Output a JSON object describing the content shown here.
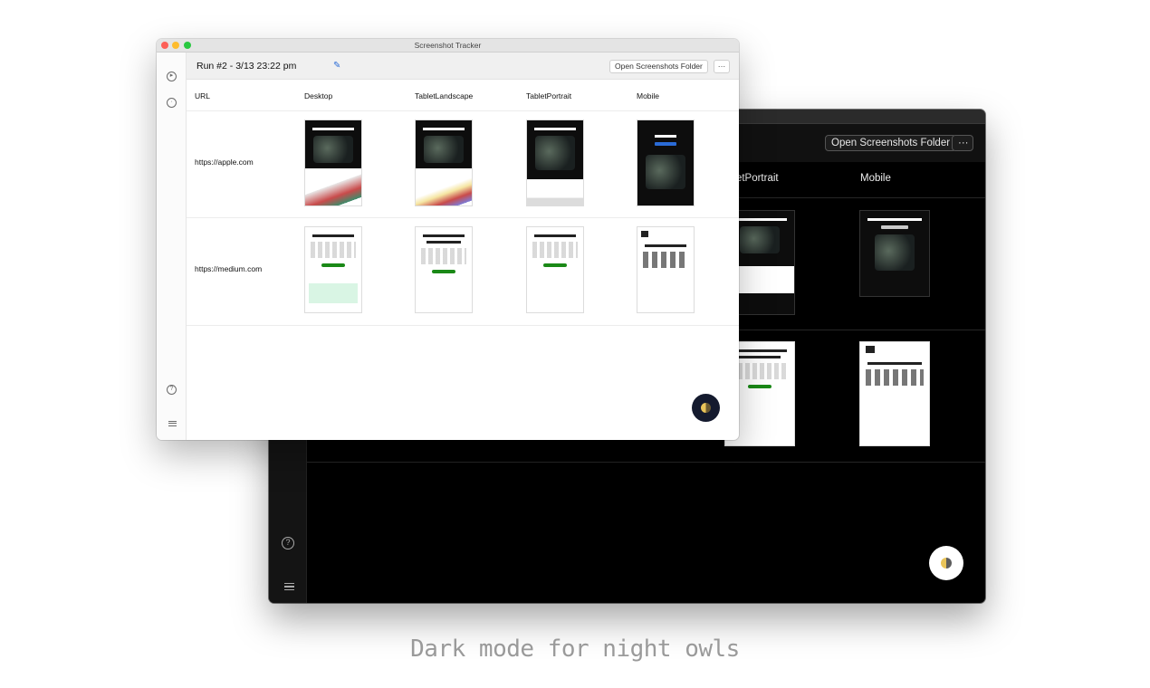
{
  "app": {
    "window_title": "Screenshot Tracker"
  },
  "run": {
    "title": "Run #2 - 3/13 23:22 pm"
  },
  "toolbar": {
    "open_folder_label": "Open Screenshots Folder",
    "more_label": "···"
  },
  "columns": [
    "URL",
    "Desktop",
    "TabletLandscape",
    "TabletPortrait",
    "Mobile"
  ],
  "rows": [
    {
      "url": "https://apple.com"
    },
    {
      "url": "https://medium.com"
    }
  ],
  "dark": {
    "columns": [
      "bletPortrait",
      "Mobile"
    ],
    "open_folder_label": "Open Screenshots Folder",
    "more_label": "···"
  },
  "icons": {
    "play": "play-circle-icon",
    "history": "clock-icon",
    "help": "question-circle-icon",
    "list": "list-indent-icon",
    "edit": "pencil-icon",
    "theme": "theme-toggle-icon"
  },
  "caption": "Dark mode for night owls",
  "colors": {
    "accent": "#2a6bd6",
    "medium_green": "#1a8917",
    "toggle_light": "#141a2e"
  }
}
